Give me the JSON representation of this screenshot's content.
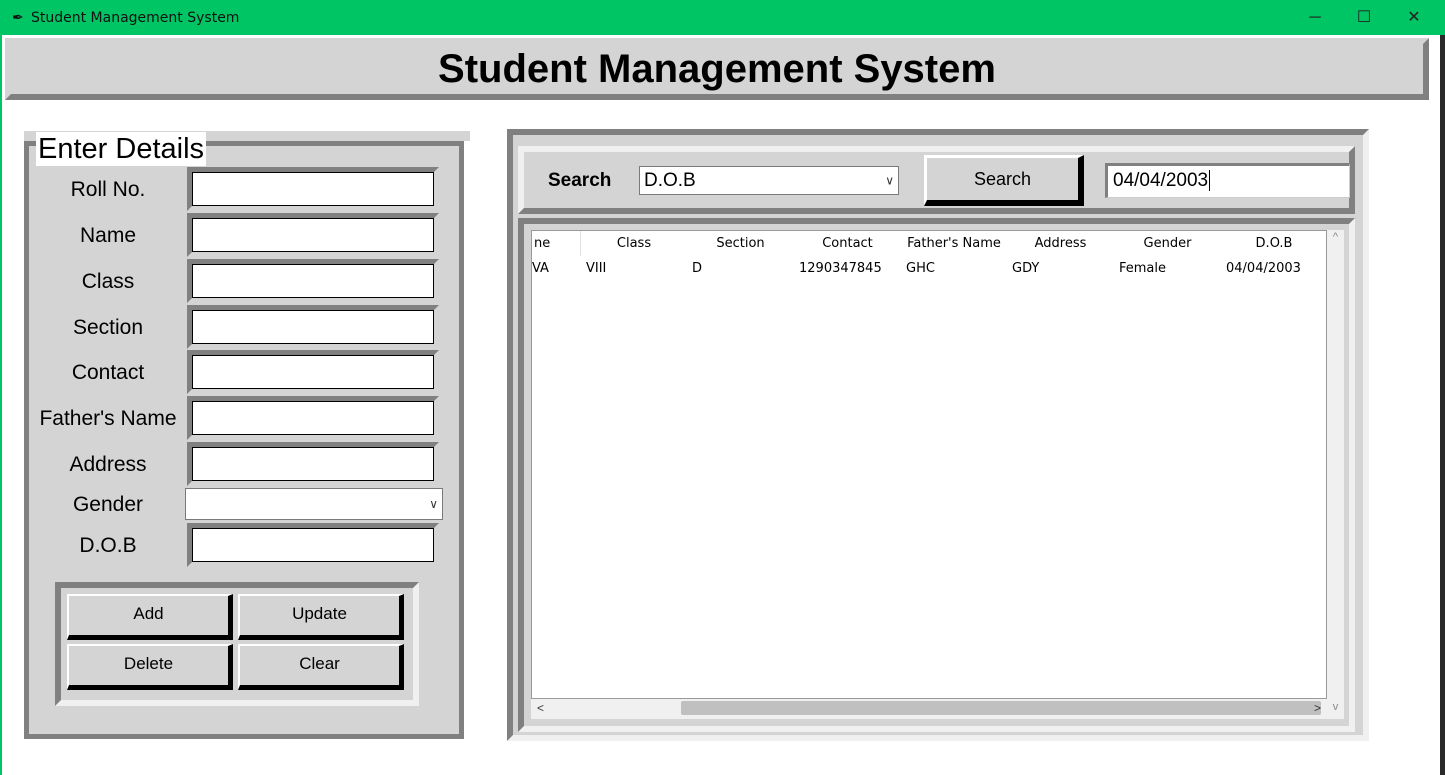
{
  "window": {
    "title": "Student Management System",
    "icon": "feather-icon",
    "minimize": "─",
    "maximize": "☐",
    "close": "✕"
  },
  "heading": "Student Management System",
  "details": {
    "legend": "Enter Details",
    "labels": {
      "roll": "Roll No.",
      "name": "Name",
      "class": "Class",
      "section": "Section",
      "contact": "Contact",
      "father": "Father's Name",
      "address": "Address",
      "gender": "Gender",
      "dob": "D.O.B"
    },
    "values": {
      "roll": "",
      "name": "",
      "class": "",
      "section": "",
      "contact": "",
      "father": "",
      "address": "",
      "gender": "",
      "dob": ""
    }
  },
  "buttons": {
    "add": "Add",
    "update": "Update",
    "delete": "Delete",
    "clear": "Clear"
  },
  "search": {
    "label": "Search",
    "by": "D.O.B",
    "button": "Search",
    "text": "04/04/2003"
  },
  "table": {
    "columns": [
      "ne",
      "Class",
      "Section",
      "Contact",
      "Father's Name",
      "Address",
      "Gender",
      "D.O.B"
    ],
    "rows": [
      [
        "VA",
        "VIII",
        "D",
        "1290347845",
        "GHC",
        "GDY",
        "Female",
        "04/04/2003"
      ]
    ]
  },
  "scroll": {
    "up": "^",
    "down": "v",
    "left": "<",
    "right": ">"
  }
}
